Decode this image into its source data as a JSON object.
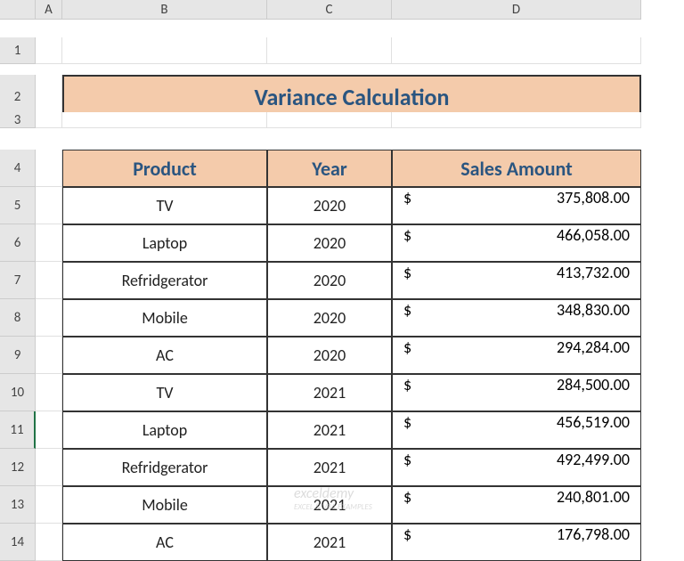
{
  "columns": [
    "A",
    "B",
    "C",
    "D"
  ],
  "rows": [
    "1",
    "2",
    "3",
    "4",
    "5",
    "6",
    "7",
    "8",
    "9",
    "10",
    "11",
    "12",
    "13",
    "14"
  ],
  "title": "Variance Calculation",
  "headers": {
    "product": "Product",
    "year": "Year",
    "amount": "Sales Amount"
  },
  "currency": "$",
  "data": [
    {
      "product": "TV",
      "year": "2020",
      "amount": "375,808.00"
    },
    {
      "product": "Laptop",
      "year": "2020",
      "amount": "466,058.00"
    },
    {
      "product": "Refridgerator",
      "year": "2020",
      "amount": "413,732.00"
    },
    {
      "product": "Mobile",
      "year": "2020",
      "amount": "348,830.00"
    },
    {
      "product": "AC",
      "year": "2020",
      "amount": "294,284.00"
    },
    {
      "product": "TV",
      "year": "2021",
      "amount": "284,500.00"
    },
    {
      "product": "Laptop",
      "year": "2021",
      "amount": "456,519.00"
    },
    {
      "product": "Refridgerator",
      "year": "2021",
      "amount": "492,499.00"
    },
    {
      "product": "Mobile",
      "year": "2021",
      "amount": "240,801.00"
    },
    {
      "product": "AC",
      "year": "2021",
      "amount": "176,798.00"
    }
  ],
  "selected_row": "11",
  "watermark": "exceldemy",
  "watermark_sub": "EXCEL & VBA EXAMPLES"
}
